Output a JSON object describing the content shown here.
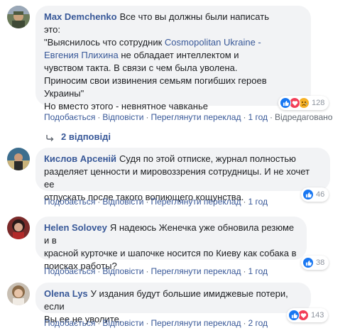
{
  "colors": {
    "link": "#385898",
    "bubble": "#f2f3f5",
    "meta": "#606770",
    "like_blue": "#1877f2",
    "love_red": "#f33e58",
    "sad_yellow": "#f7b125"
  },
  "comments": [
    {
      "author": "Max Demchenko",
      "text_lines": [
        "Все что вы должны были написать",
        "это:",
        "\"Выяснилось что сотрудник ",
        "Евгения Плихина",
        " не обладает интеллектом и",
        "чувством такта. В связи с чем была уволена.",
        "Приносим свои извинения семьям погибших героев",
        "Украины\"",
        "Но вместо этого - невнятное чавканье"
      ],
      "link_text": "Cosmopolitan Ukraine -",
      "reactions": [
        "like-icon",
        "love-icon",
        "sad-icon"
      ],
      "reaction_count": "128",
      "actions": {
        "like": "Подобається",
        "reply": "Відповісти",
        "translate": "Переглянути переклад",
        "time": "1 год",
        "edited": "Відредаговано"
      }
    },
    {
      "author": "Кислов Арсеній",
      "text_lines": [
        "Судя по этой отписке, журнал полностью",
        "разделяет ценности и мировоззрения сотрудницы. И не хочет ее",
        "отпускать после такого вопиющего кощунства."
      ],
      "reactions": [
        "like-icon"
      ],
      "reaction_count": "46",
      "actions": {
        "like": "Подобається",
        "reply": "Відповісти",
        "translate": "Переглянути переклад",
        "time": "1 год"
      }
    },
    {
      "author": "Helen Solovey",
      "text_lines": [
        "Я надеюсь Женечка уже обновила резюме и в",
        "красной курточке и шапочке носится по Киеву как собака в",
        "поисках работы?"
      ],
      "reactions": [
        "like-icon"
      ],
      "reaction_count": "38",
      "actions": {
        "like": "Подобається",
        "reply": "Відповісти",
        "translate": "Переглянути переклад",
        "time": "1 год"
      }
    },
    {
      "author": "Olena Lys",
      "text_lines": [
        "У издания будут большие имиджевые потери, если",
        "Вы ее не уволите."
      ],
      "reactions": [
        "like-icon",
        "love-icon"
      ],
      "reaction_count": "143",
      "actions": {
        "like": "Подобається",
        "reply": "Відповісти",
        "translate": "Переглянути переклад",
        "time": "2 год"
      }
    }
  ],
  "replies_label": "2 відповіді",
  "separator": "·"
}
